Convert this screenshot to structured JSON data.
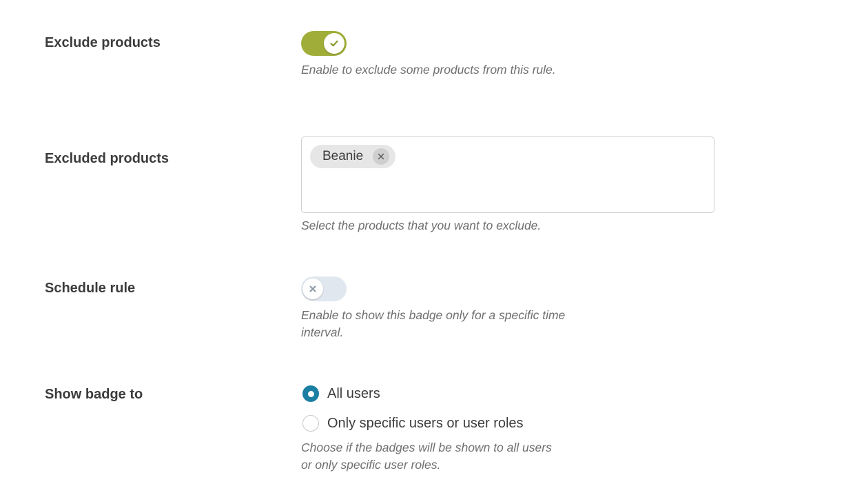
{
  "exclude_products": {
    "label": "Exclude products",
    "toggle_on": true,
    "description": "Enable to exclude some products from this rule.",
    "colors": {
      "on": "#a0ad38",
      "check": "#8a9a2b"
    }
  },
  "excluded_products": {
    "label": "Excluded products",
    "selected": [
      "Beanie"
    ],
    "description": "Select the products that you want to exclude."
  },
  "schedule_rule": {
    "label": "Schedule rule",
    "toggle_on": false,
    "description": "Enable to show this badge only for a specific time interval.",
    "colors": {
      "off": "#e1e7ee",
      "cross": "#8a97a6"
    }
  },
  "show_badge_to": {
    "label": "Show badge to",
    "options": [
      {
        "label": "All users",
        "checked": true
      },
      {
        "label": "Only specific users or user roles",
        "checked": false
      }
    ],
    "description": "Choose if the badges will be shown to all users or only specific user roles.",
    "colors": {
      "radio_checked": "#1b7fa4"
    }
  }
}
